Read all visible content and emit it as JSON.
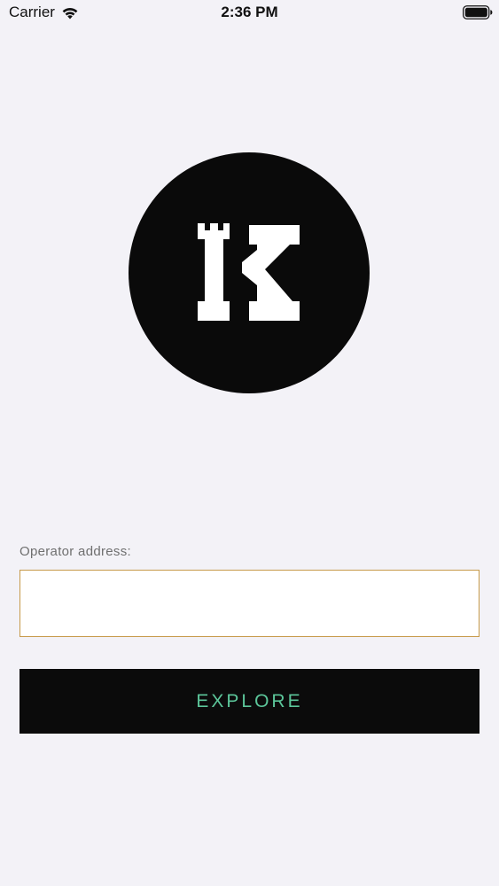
{
  "status_bar": {
    "carrier": "Carrier",
    "time": "2:36 PM",
    "wifi_icon": "wifi-icon",
    "battery_icon": "battery-icon"
  },
  "logo": {
    "icon": "castle-k-logo",
    "background_color": "#0a0a0a",
    "glyph_color": "#ffffff"
  },
  "form": {
    "label": "Operator address:",
    "input_value": "",
    "input_placeholder": "",
    "input_border_color": "#c79a4a",
    "button_label": "EXPLORE",
    "button_background": "#0b0b0b",
    "button_text_color": "#5cc69a"
  },
  "page_background": "#f3f2f7"
}
